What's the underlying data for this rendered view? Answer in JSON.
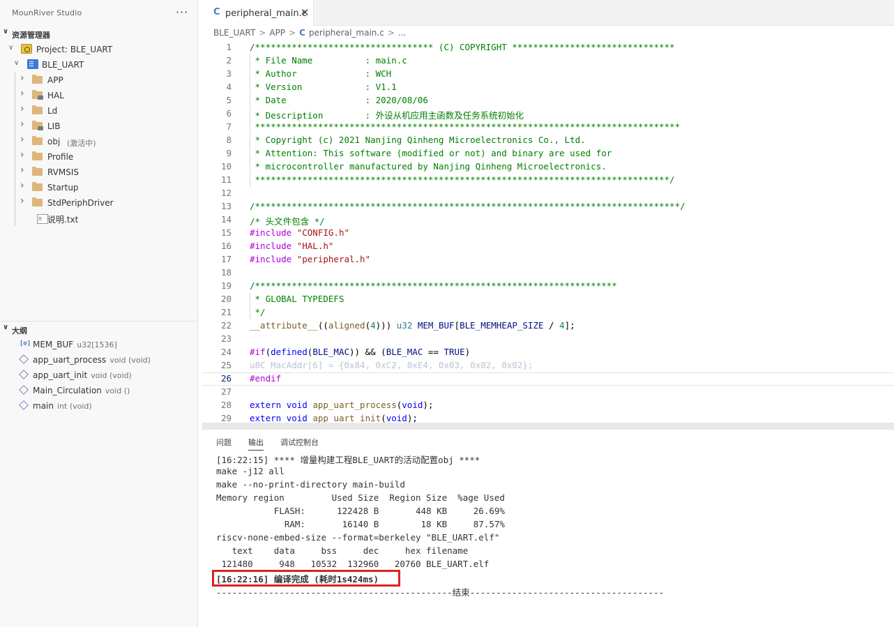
{
  "sidebar": {
    "app_title": "MounRiver Studio",
    "more_label": "···",
    "explorer_title": "资源管理器",
    "project_label": "Project: BLE_UART",
    "root_folder": "BLE_UART",
    "items": [
      {
        "label": "APP",
        "sub": ""
      },
      {
        "label": "HAL",
        "sub": ""
      },
      {
        "label": "Ld",
        "sub": ""
      },
      {
        "label": "LIB",
        "sub": ""
      },
      {
        "label": "obj",
        "sub": "(激活中)"
      },
      {
        "label": "Profile",
        "sub": ""
      },
      {
        "label": "RVMSIS",
        "sub": ""
      },
      {
        "label": "Startup",
        "sub": ""
      },
      {
        "label": "StdPeriphDriver",
        "sub": ""
      },
      {
        "label": "说明.txt",
        "sub": ""
      }
    ],
    "outline_title": "大纲",
    "outline": [
      {
        "label": "MEM_BUF",
        "sub": "u32[1536]"
      },
      {
        "label": "app_uart_process",
        "sub": "void (void)"
      },
      {
        "label": "app_uart_init",
        "sub": "void (void)"
      },
      {
        "label": "Main_Circulation",
        "sub": "void ()"
      },
      {
        "label": "main",
        "sub": "int (void)"
      }
    ]
  },
  "editor": {
    "tab_label": "peripheral_main.c",
    "tab_icon": "C",
    "breadcrumb": [
      "BLE_UART",
      "APP",
      "peripheral_main.c",
      "..."
    ],
    "active_line": 26,
    "lines": [
      [
        [
          "c",
          "/********************************** (C) COPYRIGHT *******************************"
        ]
      ],
      [
        [
          "c",
          " * File Name          : main.c"
        ]
      ],
      [
        [
          "c",
          " * Author             : WCH"
        ]
      ],
      [
        [
          "c",
          " * Version            : V1.1"
        ]
      ],
      [
        [
          "c",
          " * Date               : 2020/08/06"
        ]
      ],
      [
        [
          "c",
          " * Description        : 外设从机应用主函数及任务系统初始化"
        ]
      ],
      [
        [
          "c",
          " *********************************************************************************"
        ]
      ],
      [
        [
          "c",
          " * Copyright (c) 2021 Nanjing Qinheng Microelectronics Co., Ltd."
        ]
      ],
      [
        [
          "c",
          " * Attention: This software (modified or not) and binary are used for"
        ]
      ],
      [
        [
          "c",
          " * microcontroller manufactured by Nanjing Qinheng Microelectronics."
        ]
      ],
      [
        [
          "c",
          " *******************************************************************************/"
        ]
      ],
      [
        [
          "p",
          ""
        ]
      ],
      [
        [
          "c",
          "/*********************************************************************************/"
        ]
      ],
      [
        [
          "c",
          "/* 头文件包含 */"
        ]
      ],
      [
        [
          "pre",
          "#include "
        ],
        [
          "s",
          "\"CONFIG.h\""
        ]
      ],
      [
        [
          "pre",
          "#include "
        ],
        [
          "s",
          "\"HAL.h\""
        ]
      ],
      [
        [
          "pre",
          "#include "
        ],
        [
          "s",
          "\"peripheral.h\""
        ]
      ],
      [
        [
          "p",
          ""
        ]
      ],
      [
        [
          "c",
          "/*********************************************************************"
        ]
      ],
      [
        [
          "c",
          " * GLOBAL TYPEDEFS"
        ]
      ],
      [
        [
          "c",
          " */"
        ]
      ],
      [
        [
          "f",
          "__attribute__"
        ],
        [
          "p",
          "(("
        ],
        [
          "f",
          "aligned"
        ],
        [
          "p",
          "("
        ],
        [
          "n",
          "4"
        ],
        [
          "p",
          ")))"
        ],
        [
          "p",
          " "
        ],
        [
          "t",
          "u32"
        ],
        [
          "p",
          " "
        ],
        [
          "i",
          "MEM_BUF"
        ],
        [
          "p",
          "["
        ],
        [
          "i",
          "BLE_MEMHEAP_SIZE"
        ],
        [
          "p",
          " / "
        ],
        [
          "n",
          "4"
        ],
        [
          "p",
          "];"
        ]
      ],
      [
        [
          "p",
          ""
        ]
      ],
      [
        [
          "pre",
          "#if"
        ],
        [
          "p",
          "("
        ],
        [
          "k",
          "defined"
        ],
        [
          "p",
          "("
        ],
        [
          "i",
          "BLE_MAC"
        ],
        [
          "p",
          ")) && ("
        ],
        [
          "i",
          "BLE_MAC"
        ],
        [
          "p",
          " == "
        ],
        [
          "i",
          "TRUE"
        ],
        [
          "p",
          ")"
        ]
      ],
      [
        [
          "d",
          "u8C MacAddr[6] = {0x84, 0xC2, 0xE4, 0x03, 0x02, 0x02};"
        ]
      ],
      [
        [
          "pre",
          "#endif"
        ]
      ],
      [
        [
          "p",
          ""
        ]
      ],
      [
        [
          "k",
          "extern"
        ],
        [
          "p",
          " "
        ],
        [
          "k",
          "void"
        ],
        [
          "p",
          " "
        ],
        [
          "f",
          "app_uart_process"
        ],
        [
          "p",
          "("
        ],
        [
          "k",
          "void"
        ],
        [
          "p",
          ");"
        ]
      ],
      [
        [
          "k",
          "extern"
        ],
        [
          "p",
          " "
        ],
        [
          "k",
          "void"
        ],
        [
          "p",
          " "
        ],
        [
          "f",
          "app uart init"
        ],
        [
          "p",
          "("
        ],
        [
          "k",
          "void"
        ],
        [
          "p",
          ");"
        ]
      ]
    ]
  },
  "panel": {
    "tabs": [
      "问题",
      "输出",
      "调试控制台"
    ],
    "active_tab": 1,
    "output": [
      "[16:22:15] **** 增量构建工程BLE_UART的活动配置obj ****",
      "make -j12 all",
      "make --no-print-directory main-build",
      "Memory region         Used Size  Region Size  %age Used",
      "           FLASH:      122428 B       448 KB     26.69%",
      "             RAM:       16140 B        18 KB     87.57%",
      "riscv-none-embed-size --format=berkeley \"BLE_UART.elf\"",
      "   text    data     bss     dec     hex filename",
      " 121480     948   10532  132960   20760 BLE_UART.elf",
      "[16:22:16] 编译完成 (耗时1s424ms)",
      "---------------------------------------------结束-------------------------------------"
    ]
  }
}
